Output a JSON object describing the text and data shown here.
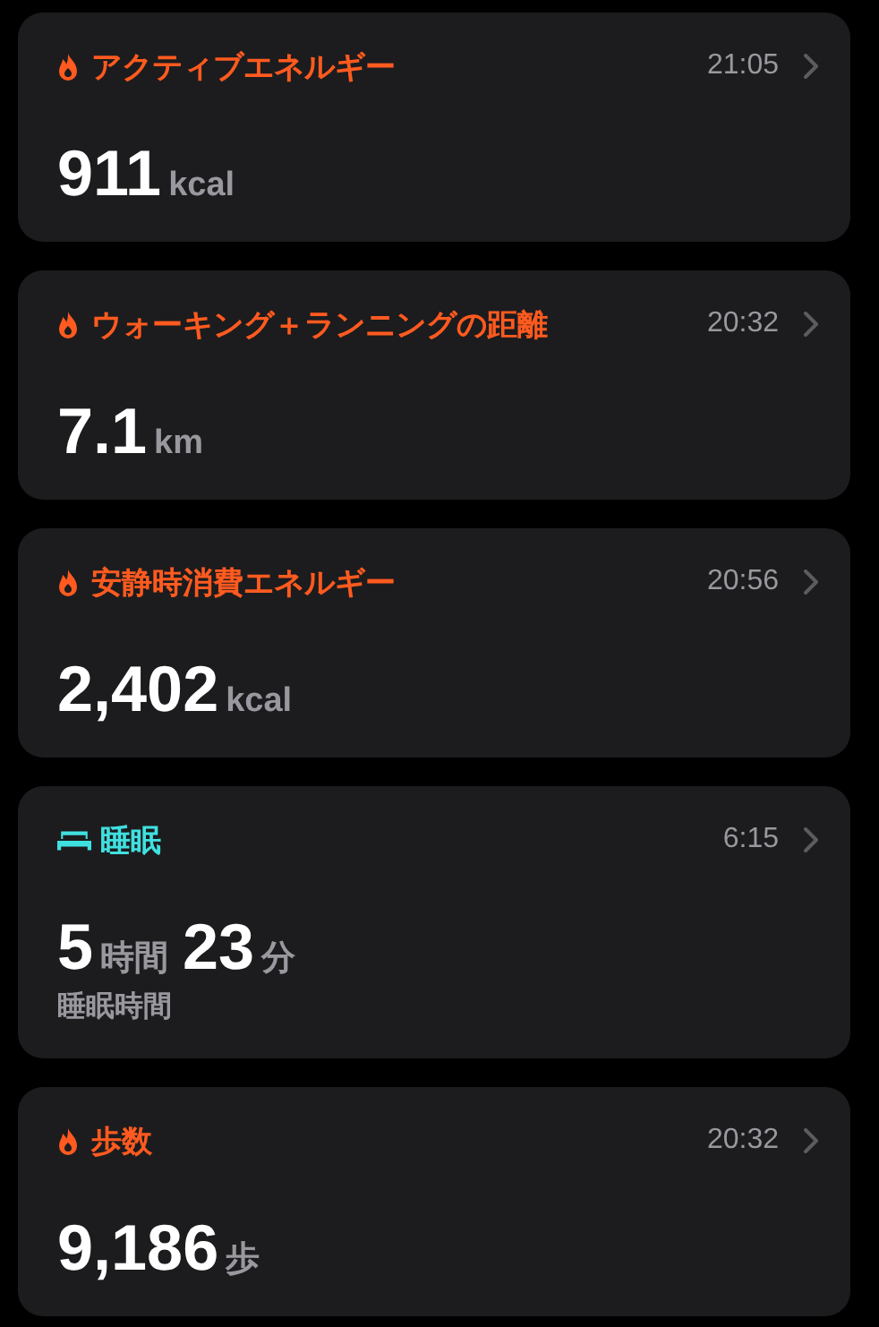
{
  "cards": [
    {
      "kind": "flame",
      "color": "#ff5a1f",
      "title": "アクティブエネルギー",
      "time": "21:05",
      "value": [
        {
          "number": "911",
          "unit": "kcal"
        }
      ]
    },
    {
      "kind": "flame",
      "color": "#ff5a1f",
      "title": "ウォーキング＋ランニングの距離",
      "time": "20:32",
      "value": [
        {
          "number": "7.1",
          "unit": "km"
        }
      ]
    },
    {
      "kind": "flame",
      "color": "#ff5a1f",
      "title": "安静時消費エネルギー",
      "time": "20:56",
      "value": [
        {
          "number": "2,402",
          "unit": "kcal"
        }
      ]
    },
    {
      "kind": "bed",
      "color": "#40e0e0",
      "title": "睡眠",
      "time": "6:15",
      "value": [
        {
          "number": "5",
          "unit": "時間"
        },
        {
          "number": "23",
          "unit": "分"
        }
      ],
      "subtitle": "睡眠時間"
    },
    {
      "kind": "flame",
      "color": "#ff5a1f",
      "title": "歩数",
      "time": "20:32",
      "value": [
        {
          "number": "9,186",
          "unit": "歩"
        }
      ]
    }
  ]
}
